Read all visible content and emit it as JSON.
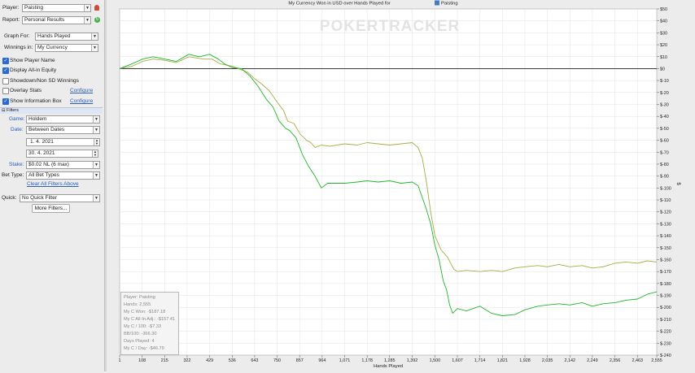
{
  "left_panel": {
    "player_label": "Player:",
    "player_value": "Paisting",
    "report_label": "Report:",
    "report_value": "Personal Results",
    "graph_for_label": "Graph For:",
    "graph_for_value": "Hands Played",
    "winnings_in_label": "Winnings in:",
    "winnings_in_value": "My Currency",
    "options": [
      {
        "label": "Show Player Name",
        "checked": true
      },
      {
        "label": "Display All-in Equity",
        "checked": true
      },
      {
        "label": "Showdown/Non SD Winnings",
        "checked": false
      },
      {
        "label": "Overlay Stats",
        "checked": false,
        "link": "Configure"
      },
      {
        "label": "Show Information Box",
        "checked": true,
        "link": "Configure"
      }
    ],
    "filters_header": "Filters",
    "game_label": "Game:",
    "game_value": "Holdem",
    "date_label": "Date:",
    "date_value": "Between Dates",
    "date_from": "1. 4. 2021",
    "date_to": "30. 4. 2021",
    "stake_label": "Stake:",
    "stake_value": "$0.02 NL (6 max)",
    "bet_type_label": "Bet Type:",
    "bet_type_value": "All Bet Types",
    "clear_filters": "Clear All Filters Above",
    "quick_label": "Quick:",
    "quick_value": "No Quick Filter",
    "more_filters": "More Filters..."
  },
  "colors": {
    "allin_adjusted": "#a8ac48",
    "won": "#1fb52a",
    "link": "#2b5fb8"
  },
  "chart_data": {
    "type": "line",
    "title": "My Currency Won in USD over Hands Played for",
    "title_player": "Paisting",
    "watermark": "POKERTRACKER",
    "xlabel": "Hands Played",
    "ylabel": "$",
    "xlim": [
      1,
      2555
    ],
    "ylim": [
      -240,
      50
    ],
    "x_ticks": [
      "1",
      "108",
      "215",
      "322",
      "429",
      "536",
      "643",
      "750",
      "857",
      "964",
      "1,071",
      "1,178",
      "1,285",
      "1,392",
      "1,500",
      "1,607",
      "1,714",
      "1,821",
      "1,928",
      "2,035",
      "2,142",
      "2,249",
      "2,356",
      "2,463",
      "2,555"
    ],
    "y_ticks": [
      "$50",
      "$40",
      "$30",
      "$20",
      "$10",
      "$0",
      "$-10",
      "$-20",
      "$-30",
      "$-40",
      "$-50",
      "$-60",
      "$-70",
      "$-80",
      "$-90",
      "$-100",
      "$-110",
      "$-120",
      "$-130",
      "$-140",
      "$-150",
      "$-160",
      "$-170",
      "$-180",
      "$-190",
      "$-200",
      "$-210",
      "$-220",
      "$-230",
      "$-240"
    ],
    "grid": true,
    "series": [
      {
        "name": "My C All-In Adj.",
        "points": [
          [
            1,
            0
          ],
          [
            60,
            2
          ],
          [
            110,
            6
          ],
          [
            160,
            8
          ],
          [
            215,
            7
          ],
          [
            270,
            5
          ],
          [
            330,
            10
          ],
          [
            400,
            8
          ],
          [
            440,
            8
          ],
          [
            480,
            4
          ],
          [
            536,
            2
          ],
          [
            580,
            -1
          ],
          [
            610,
            -3
          ],
          [
            640,
            -8
          ],
          [
            670,
            -12
          ],
          [
            710,
            -18
          ],
          [
            750,
            -28
          ],
          [
            780,
            -35
          ],
          [
            800,
            -44
          ],
          [
            830,
            -46
          ],
          [
            860,
            -55
          ],
          [
            890,
            -60
          ],
          [
            910,
            -62
          ],
          [
            930,
            -66
          ],
          [
            960,
            -64
          ],
          [
            1000,
            -65
          ],
          [
            1071,
            -63
          ],
          [
            1130,
            -64
          ],
          [
            1178,
            -62
          ],
          [
            1230,
            -63
          ],
          [
            1285,
            -64
          ],
          [
            1340,
            -63
          ],
          [
            1392,
            -62
          ],
          [
            1420,
            -66
          ],
          [
            1440,
            -75
          ],
          [
            1460,
            -95
          ],
          [
            1480,
            -120
          ],
          [
            1500,
            -140
          ],
          [
            1530,
            -152
          ],
          [
            1560,
            -158
          ],
          [
            1590,
            -168
          ],
          [
            1607,
            -170
          ],
          [
            1650,
            -169
          ],
          [
            1714,
            -170
          ],
          [
            1770,
            -169
          ],
          [
            1821,
            -170
          ],
          [
            1880,
            -167
          ],
          [
            1928,
            -166
          ],
          [
            1990,
            -165
          ],
          [
            2035,
            -166
          ],
          [
            2090,
            -164
          ],
          [
            2142,
            -166
          ],
          [
            2200,
            -165
          ],
          [
            2249,
            -167
          ],
          [
            2300,
            -166
          ],
          [
            2356,
            -163
          ],
          [
            2410,
            -162
          ],
          [
            2463,
            -163
          ],
          [
            2510,
            -161
          ],
          [
            2555,
            -162
          ]
        ]
      },
      {
        "name": "My C Won",
        "points": [
          [
            1,
            0
          ],
          [
            60,
            4
          ],
          [
            110,
            8
          ],
          [
            160,
            10
          ],
          [
            215,
            8
          ],
          [
            270,
            6
          ],
          [
            330,
            12
          ],
          [
            380,
            10
          ],
          [
            429,
            12
          ],
          [
            470,
            8
          ],
          [
            500,
            4
          ],
          [
            536,
            1
          ],
          [
            580,
            0
          ],
          [
            620,
            -6
          ],
          [
            660,
            -15
          ],
          [
            700,
            -26
          ],
          [
            730,
            -32
          ],
          [
            760,
            -44
          ],
          [
            790,
            -50
          ],
          [
            810,
            -52
          ],
          [
            840,
            -58
          ],
          [
            870,
            -72
          ],
          [
            900,
            -82
          ],
          [
            930,
            -90
          ],
          [
            960,
            -100
          ],
          [
            990,
            -96
          ],
          [
            1071,
            -96
          ],
          [
            1130,
            -95
          ],
          [
            1178,
            -94
          ],
          [
            1230,
            -95
          ],
          [
            1285,
            -94
          ],
          [
            1340,
            -96
          ],
          [
            1392,
            -95
          ],
          [
            1420,
            -98
          ],
          [
            1440,
            -108
          ],
          [
            1460,
            -118
          ],
          [
            1480,
            -130
          ],
          [
            1500,
            -148
          ],
          [
            1520,
            -160
          ],
          [
            1540,
            -178
          ],
          [
            1555,
            -185
          ],
          [
            1570,
            -198
          ],
          [
            1585,
            -205
          ],
          [
            1607,
            -201
          ],
          [
            1650,
            -203
          ],
          [
            1714,
            -199
          ],
          [
            1770,
            -205
          ],
          [
            1821,
            -207
          ],
          [
            1880,
            -206
          ],
          [
            1928,
            -202
          ],
          [
            1990,
            -199
          ],
          [
            2035,
            -198
          ],
          [
            2090,
            -197
          ],
          [
            2142,
            -198
          ],
          [
            2200,
            -196
          ],
          [
            2249,
            -199
          ],
          [
            2300,
            -197
          ],
          [
            2356,
            -196
          ],
          [
            2410,
            -194
          ],
          [
            2463,
            -193
          ],
          [
            2510,
            -189
          ],
          [
            2555,
            -187
          ]
        ]
      }
    ],
    "info_box": {
      "player_line": "Player: Paisting",
      "hands_line": "Hands: 2,555",
      "won_line": "My C Won: -$187.18",
      "allin_line": "My C All-In Adj.: -$157.41",
      "per100_line": "My C / 100: -$7.33",
      "bb100_line": "BB/100: -366.30",
      "days_line": "Days Played: 4",
      "perday_line": "My C / Day: -$46.79"
    }
  }
}
